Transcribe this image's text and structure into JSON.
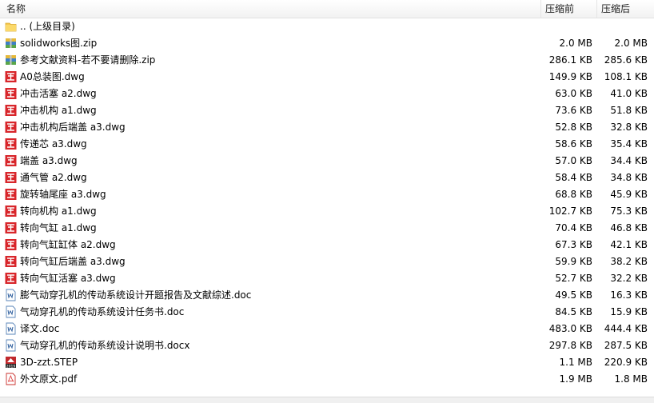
{
  "columns": {
    "name": "名称",
    "packed": "压缩前",
    "unpacked": "压缩后"
  },
  "files": [
    {
      "name": ".. (上级目录)",
      "packed": "",
      "unpacked": "",
      "icon": "folder-icon"
    },
    {
      "name": "solidworks图.zip",
      "packed": "2.0 MB",
      "unpacked": "2.0 MB",
      "icon": "zip-archive-icon"
    },
    {
      "name": "参考文献资料-若不要请删除.zip",
      "packed": "286.1 KB",
      "unpacked": "285.6 KB",
      "icon": "zip-archive-icon"
    },
    {
      "name": "A0总装图.dwg",
      "packed": "149.9 KB",
      "unpacked": "108.1 KB",
      "icon": "dwg-file-icon"
    },
    {
      "name": "冲击活塞 a2.dwg",
      "packed": "63.0 KB",
      "unpacked": "41.0 KB",
      "icon": "dwg-file-icon"
    },
    {
      "name": "冲击机构 a1.dwg",
      "packed": "73.6 KB",
      "unpacked": "51.8 KB",
      "icon": "dwg-file-icon"
    },
    {
      "name": "冲击机构后端盖 a3.dwg",
      "packed": "52.8 KB",
      "unpacked": "32.8 KB",
      "icon": "dwg-file-icon"
    },
    {
      "name": "传递芯 a3.dwg",
      "packed": "58.6 KB",
      "unpacked": "35.4 KB",
      "icon": "dwg-file-icon"
    },
    {
      "name": "端盖 a3.dwg",
      "packed": "57.0 KB",
      "unpacked": "34.4 KB",
      "icon": "dwg-file-icon"
    },
    {
      "name": "通气管 a2.dwg",
      "packed": "58.4 KB",
      "unpacked": "34.8 KB",
      "icon": "dwg-file-icon"
    },
    {
      "name": "旋转轴尾座 a3.dwg",
      "packed": "68.8 KB",
      "unpacked": "45.9 KB",
      "icon": "dwg-file-icon"
    },
    {
      "name": "转向机构 a1.dwg",
      "packed": "102.7 KB",
      "unpacked": "75.3 KB",
      "icon": "dwg-file-icon"
    },
    {
      "name": "转向气缸 a1.dwg",
      "packed": "70.4 KB",
      "unpacked": "46.8 KB",
      "icon": "dwg-file-icon"
    },
    {
      "name": "转向气缸缸体 a2.dwg",
      "packed": "67.3 KB",
      "unpacked": "42.1 KB",
      "icon": "dwg-file-icon"
    },
    {
      "name": "转向气缸后端盖 a3.dwg",
      "packed": "59.9 KB",
      "unpacked": "38.2 KB",
      "icon": "dwg-file-icon"
    },
    {
      "name": "转向气缸活塞 a3.dwg",
      "packed": "52.7 KB",
      "unpacked": "32.2 KB",
      "icon": "dwg-file-icon"
    },
    {
      "name": "膨气动穿孔机的传动系统设计开题报告及文献综述.doc",
      "packed": "49.5 KB",
      "unpacked": "16.3 KB",
      "icon": "word-doc-icon"
    },
    {
      "name": "气动穿孔机的传动系统设计任务书.doc",
      "packed": "84.5 KB",
      "unpacked": "15.9 KB",
      "icon": "word-doc-icon"
    },
    {
      "name": "译文.doc",
      "packed": "483.0 KB",
      "unpacked": "444.4 KB",
      "icon": "word-doc-icon"
    },
    {
      "name": "气动穿孔机的传动系统设计说明书.docx",
      "packed": "297.8 KB",
      "unpacked": "287.5 KB",
      "icon": "word-doc-icon"
    },
    {
      "name": "3D-zzt.STEP",
      "packed": "1.1 MB",
      "unpacked": "220.9 KB",
      "icon": "step-file-icon"
    },
    {
      "name": "外文原文.pdf",
      "packed": "1.9 MB",
      "unpacked": "1.8 MB",
      "icon": "pdf-file-icon"
    }
  ]
}
